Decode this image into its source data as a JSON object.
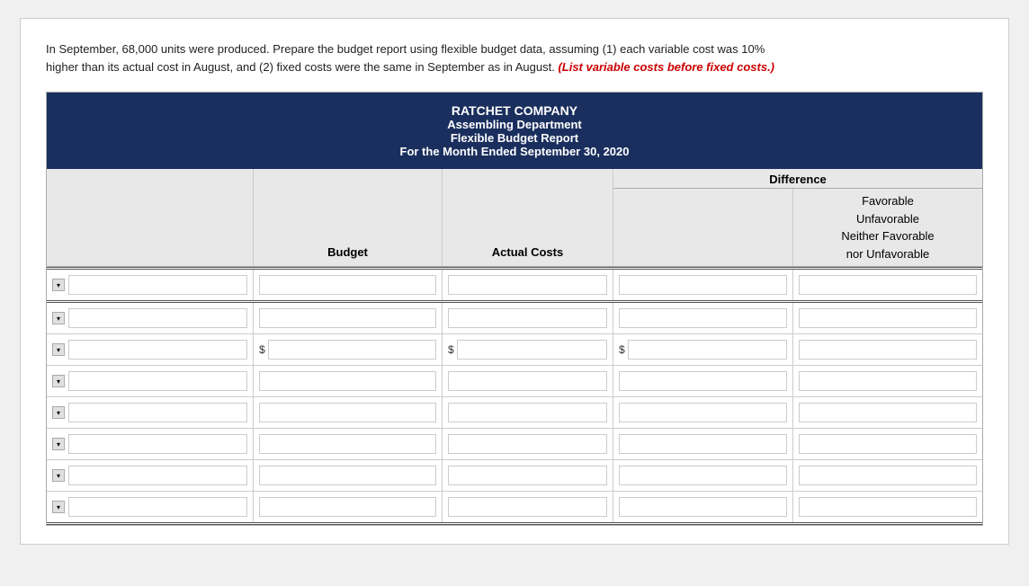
{
  "intro": {
    "text1": "In September, 68,000 units were produced. Prepare the budget report using flexible budget data, assuming (1) each variable cost was 10%",
    "text2": "higher than its actual cost in August, and (2) fixed costs were the same in September as in August.",
    "italic": "(List variable costs before fixed costs.)"
  },
  "report": {
    "company": "RATCHET COMPANY",
    "department": "Assembling Department",
    "title": "Flexible Budget Report",
    "period": "For the Month Ended September 30, 2020",
    "columns": {
      "budget": "Budget",
      "actual": "Actual Costs",
      "difference": "Difference",
      "diff_sub": {
        "favorable": "Favorable",
        "unfavorable": "Unfavorable",
        "neither": "Neither Favorable",
        "nor": "nor Unfavorable"
      }
    }
  },
  "rows": [
    {
      "id": 1,
      "has_dollar": true,
      "is_double_border": false
    },
    {
      "id": 2,
      "has_dollar": false,
      "is_double_border": false
    },
    {
      "id": 3,
      "has_dollar": true,
      "is_double_border": false
    },
    {
      "id": 4,
      "has_dollar": false,
      "is_double_border": false
    },
    {
      "id": 5,
      "has_dollar": false,
      "is_double_border": false
    },
    {
      "id": 6,
      "has_dollar": false,
      "is_double_border": false
    },
    {
      "id": 7,
      "has_dollar": false,
      "is_double_border": false
    },
    {
      "id": 8,
      "has_dollar": false,
      "is_double_border": false
    }
  ]
}
